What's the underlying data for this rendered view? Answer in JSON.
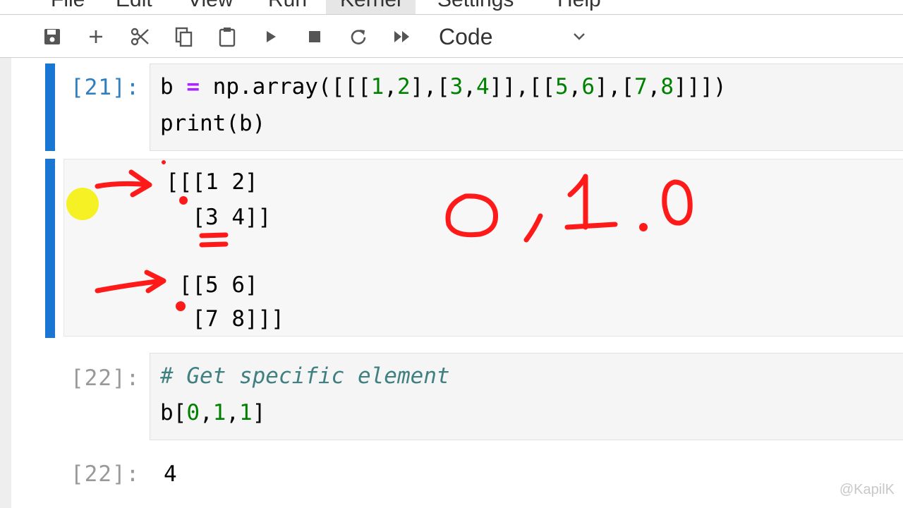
{
  "menubar": {
    "items": [
      "File",
      "Edit",
      "View",
      "Run",
      "Kernel",
      "Settings",
      "Help"
    ]
  },
  "toolbar": {
    "icons": [
      "save-icon",
      "add-icon",
      "cut-icon",
      "copy-icon",
      "paste-icon",
      "run-icon",
      "stop-icon",
      "restart-icon",
      "fast-forward-icon"
    ],
    "cell_type": "Code"
  },
  "cells": [
    {
      "prompt": "[21]:",
      "code_lines": [
        "b = np.array([[[1,2],[3,4]],[[5,6],[7,8]]])",
        "print(b)"
      ],
      "output_lines": [
        "[[[1 2]",
        "  [3 4]]",
        "",
        " [[5 6]",
        "  [7 8]]]"
      ]
    },
    {
      "prompt": "[22]:",
      "code_lines": [
        "# Get specific element",
        "b[0,1,1]"
      ],
      "output_prompt": "[22]:",
      "output_value": "4"
    }
  ],
  "annotation_text": "0,1,0",
  "watermark": "@KapilK",
  "colors": {
    "active_cell_bar": "#1976d2",
    "annotation_ink": "#ff0000",
    "prompt_active": "#307fc1",
    "highlighter": "#f4f000"
  }
}
